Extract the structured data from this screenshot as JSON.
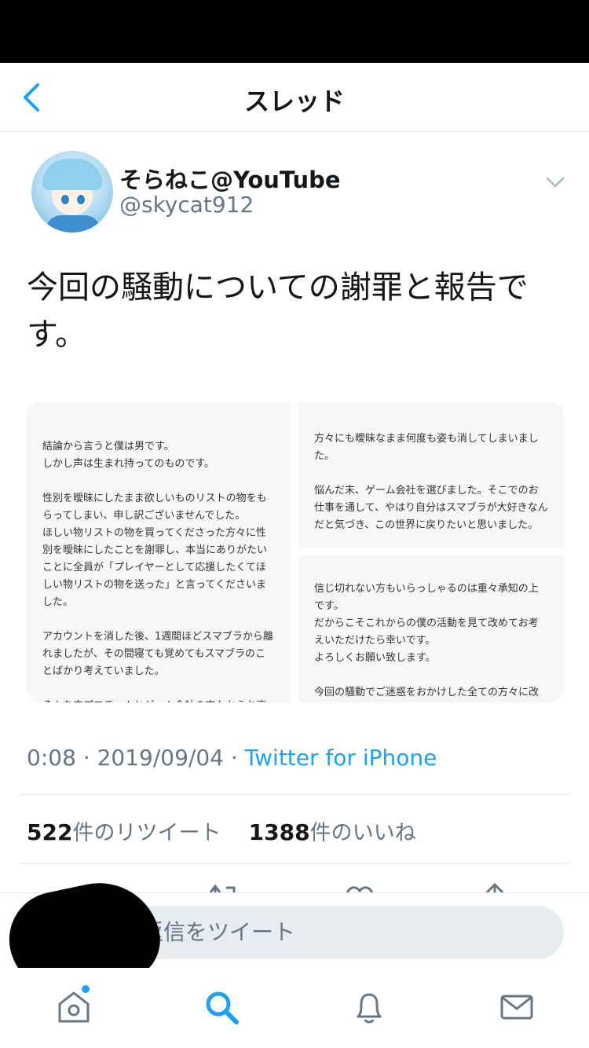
{
  "header": {
    "title": "スレッド"
  },
  "tweet": {
    "display_name": "そらねこ@YouTube",
    "handle": "@skycat912",
    "text": "今回の騒動についての謝罪と報告です。",
    "attachment_left": "結論から言うと僕は男です。\nしかし声は生まれ持ってのものです。\n\n性別を曖昧にしたまま欲しいものリストの物をもらってしまい、申し訳ございませんでした。\nほしい物リストの物を買ってくださった方々に性別を曖昧にしたことを謝罪し、本当にありがたいことに全員が「プレイヤーとして応援したくてほしい物リストの物を送った」と言ってくださいました。\n\nアカウントを消した後、1週間ほどスマブラから離れましたが、その間寝ても覚めてもスマブラのことばかり考えていました。\n\nそんな中プロチームとゲーム会社の方々からお声をいただき、自分の今までの行いや姿勢",
    "attachment_right_top": "方々にも曖昧なまま何度も姿も消してしまいました。\n\n悩んだ末、ゲーム会社を選びました。そこでのお仕事を通して、やはり自分はスマブラが大好きなんだと気づき、この世界に戻りたいと思いました。\n\nこれからは態度や姿勢でルフレ使いとして貢",
    "attachment_right_bottom": "信じ切れない方もいらっしゃるのは重々承知の上です。\nだからこそこれからの僕の活動を見て改めてお考えいただけたら幸いです。\nよろしくお願い致します。\n\n今回の騒動でご迷惑をおかけした全ての方々に改めて謝罪をさせていただきます。\n大変申し訳ございませんでした。",
    "time": "0:08 · 2019/09/04 · ",
    "client": "Twitter for iPhone"
  },
  "stats": {
    "retweet_count": "522",
    "retweet_label": "件のリツイート",
    "like_count": "1388",
    "like_label": "件のいいね"
  },
  "reply": {
    "placeholder": "返信をツイート",
    "visible_text": "返信をツイート"
  },
  "tabs": [
    "home-icon",
    "search-icon",
    "notifications-icon",
    "messages-icon"
  ],
  "colors": {
    "accent": "#1da1f2",
    "text": "#14171a",
    "muted": "#657786"
  }
}
